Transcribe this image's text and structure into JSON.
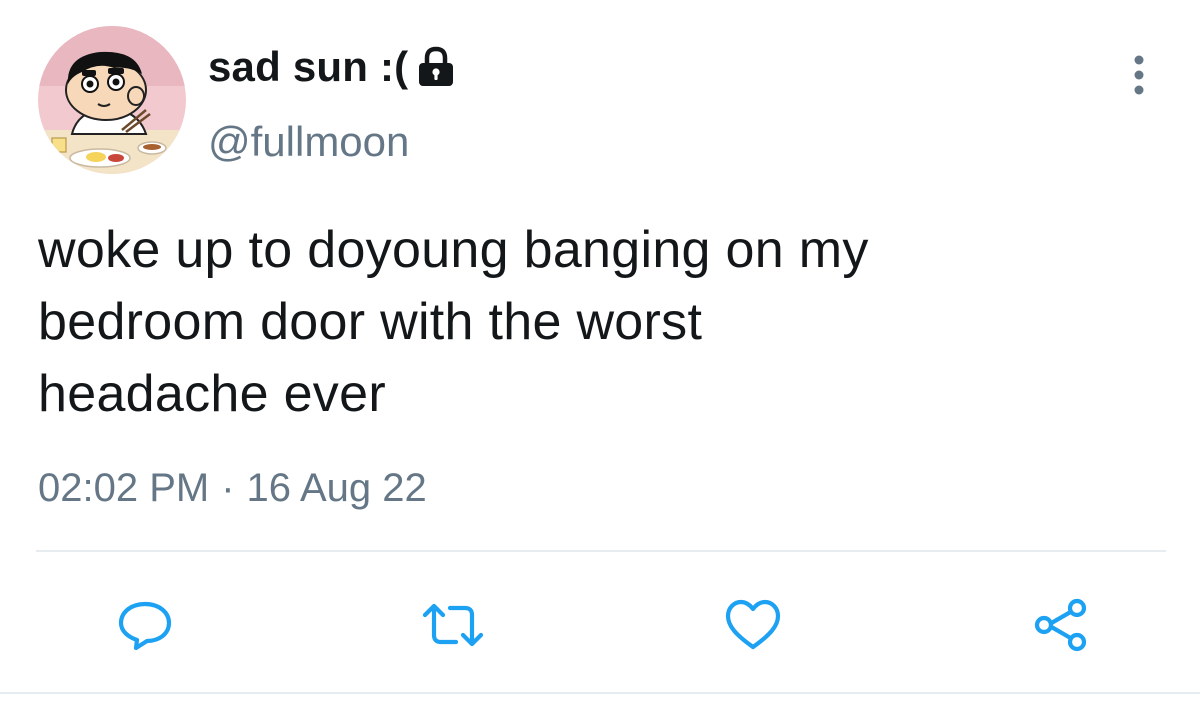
{
  "author": {
    "display_name": "sad sun :(",
    "username": "@fullmoon",
    "avatar_icon": "cartoon-avatar",
    "protected_icon": "lock-icon"
  },
  "tweet": {
    "text": "woke up to doyoung banging on my\nbedroom door with the worst\nheadache ever",
    "time": "02:02 PM",
    "separator": "·",
    "date": "16 Aug 22"
  },
  "actions": [
    {
      "name": "reply",
      "icon": "reply-icon"
    },
    {
      "name": "retweet",
      "icon": "retweet-icon"
    },
    {
      "name": "like",
      "icon": "heart-icon"
    },
    {
      "name": "share",
      "icon": "share-icon"
    }
  ],
  "menu_icon": "more-vertical-icon",
  "colors": {
    "text": "#14171a",
    "secondary": "#657786",
    "icon": "#1da1f2",
    "divider": "#e6ecf0"
  }
}
